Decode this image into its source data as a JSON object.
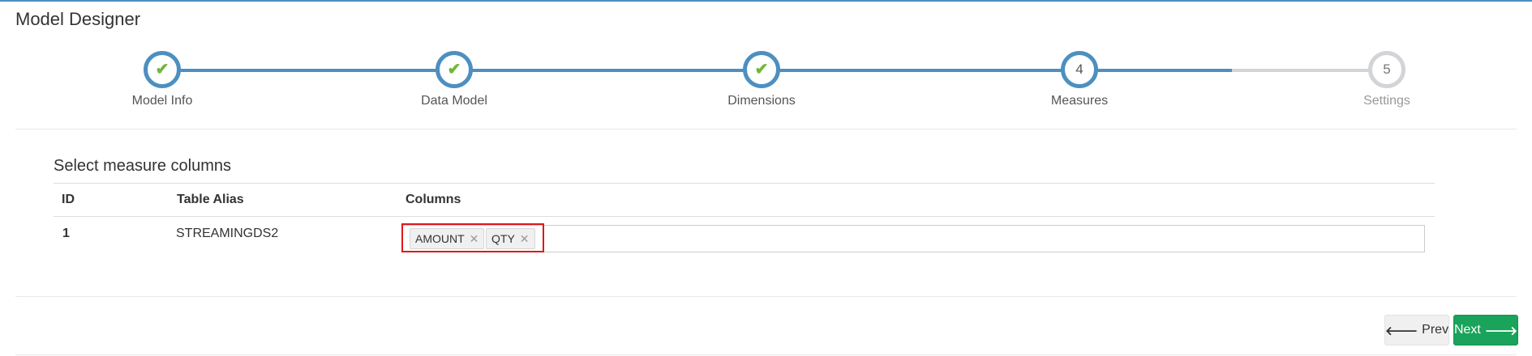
{
  "page": {
    "title": "Model Designer"
  },
  "wizard": {
    "steps": [
      {
        "label": "Model Info",
        "number": "1",
        "state": "done"
      },
      {
        "label": "Data Model",
        "number": "2",
        "state": "done"
      },
      {
        "label": "Dimensions",
        "number": "3",
        "state": "done"
      },
      {
        "label": "Measures",
        "number": "4",
        "state": "current"
      },
      {
        "label": "Settings",
        "number": "5",
        "state": "todo"
      }
    ]
  },
  "measures": {
    "section_title": "Select measure columns",
    "headers": {
      "id": "ID",
      "alias": "Table Alias",
      "columns": "Columns"
    },
    "rows": [
      {
        "id": "1",
        "alias": "STREAMINGDS2",
        "tags": [
          "AMOUNT",
          "QTY"
        ]
      }
    ]
  },
  "footer": {
    "prev_label": "Prev",
    "next_label": "Next"
  },
  "icons": {
    "done_step": "check-icon",
    "prev": "arrow-left-icon",
    "next": "arrow-right-icon",
    "remove_tag": "close-icon"
  },
  "colors": {
    "accent": "#4d8fc0",
    "check": "#72b63a",
    "next_button": "#1aa35a",
    "highlight": "#e0181b",
    "pending": "#d2d4d8"
  }
}
